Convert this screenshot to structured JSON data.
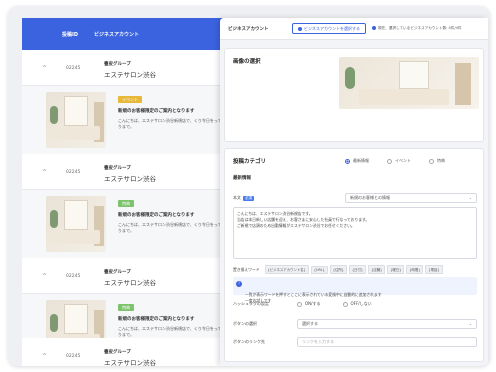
{
  "list": {
    "header": {
      "col1": "投稿ID",
      "col2": "ビジネスアカウント",
      "col3": "登"
    },
    "rows": [
      {
        "chevron": "^",
        "id": "02245",
        "group": "書皮グループ",
        "salon": "エステサロン渋谷",
        "year": "202"
      },
      {
        "chevron": "^",
        "id": "02245",
        "group": "書皮グループ",
        "salon": "エステサロン渋谷",
        "year": "202"
      },
      {
        "chevron": "^",
        "id": "02245",
        "group": "書皮グループ",
        "salon": "エステサロン渋谷",
        "year": "202"
      },
      {
        "chevron": "^",
        "id": "02245",
        "group": "書皮グループ",
        "salon": "エステサロン渋谷",
        "year": "202"
      }
    ],
    "posts": [
      {
        "badge": "イベント",
        "badge_color": "#e8b83a",
        "title": "新規のお客様限定のご案内となります",
        "body": "こんにちは、エステサロン渋谷新規店で、くり令日をっておりまで。",
        "year": "202"
      },
      {
        "badge": "特典",
        "badge_color": "#7cc36c",
        "title": "新規のお客様限定のご案内となります",
        "body": "こんにちは、エステサロン渋谷新規店で、くり令日をっておりまで。",
        "year": "202"
      },
      {
        "badge": "特典",
        "badge_color": "#7cc36c",
        "title": "新規のお客様限定のご案内となります",
        "body": "こんにちは、エステサロン渋谷新規店で、くり令日をっておりまで。",
        "year": "202"
      }
    ]
  },
  "form": {
    "top": {
      "business_label": "ビジネスアカウント",
      "select_button": "ビジネスアカウントを選択する",
      "note": "現在、選択しているビジネスアカウント数: 4件/4件"
    },
    "image_section": {
      "title": "画像の選択"
    },
    "category_section": {
      "title": "投稿カテゴリ",
      "radios": [
        "最新情報",
        "イベント",
        "特典"
      ],
      "selected_radio": "最新情報",
      "subtitle": "最新情報",
      "body_label": "本文",
      "required_label": "必須",
      "template_select": "新規のお客様との情報",
      "body_text": "こんにちは、エステサロン渋谷新規店です。\n当店は本日新しい店舗を迎え、お客さまに安心した社員で行なっております。\nご新規で店頭のため出勤情報がエステサロン渋谷でお任せください。",
      "tags_label": "置き換えワード",
      "tags": [
        "{ビジネスアカウント名}",
        "{URL}",
        "{住所}",
        "{日付}",
        "{店舗}",
        "{曜日}",
        "{時間}",
        "{電話}"
      ],
      "info_text": "一覧が表示ワードを押すとここに表示されている変換中に自動的に追加されます\n一度お試しです",
      "hashtag_label": "ハッシュタグの設定",
      "hashtag_options": [
        "ON/する",
        "OFF/しない"
      ],
      "button_label": "ボタンの選択",
      "button_placeholder": "選択する",
      "link_label": "ボタンのリンク先",
      "link_placeholder": "リンクを入力する"
    }
  }
}
